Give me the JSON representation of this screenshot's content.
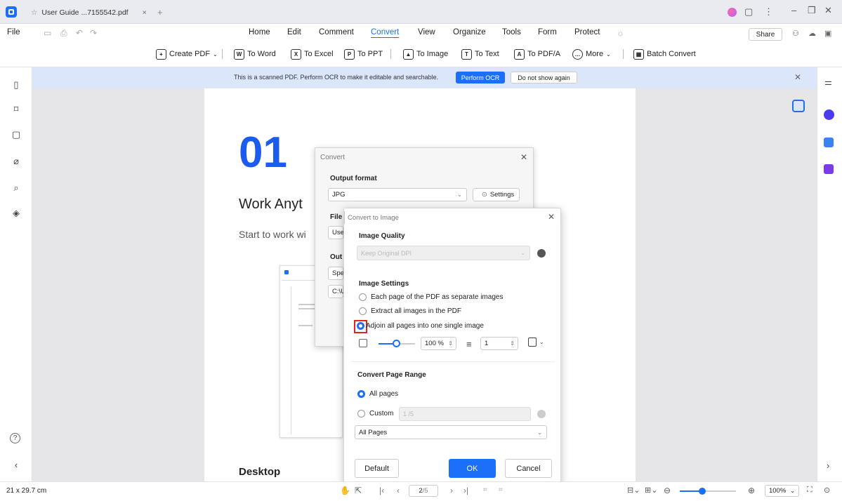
{
  "tab": {
    "title": "User Guide ...7155542.pdf"
  },
  "menubar": {
    "file": "File",
    "items": [
      "Home",
      "Edit",
      "Comment",
      "Convert",
      "View",
      "Organize",
      "Tools",
      "Form",
      "Protect"
    ],
    "share": "Share"
  },
  "toolbar": {
    "create_pdf": "Create PDF",
    "to_word": "To Word",
    "to_excel": "To Excel",
    "to_ppt": "To PPT",
    "to_image": "To Image",
    "to_text": "To Text",
    "to_pdfa": "To PDF/A",
    "more": "More",
    "batch_convert": "Batch Convert"
  },
  "ocr_bar": {
    "message": "This is a scanned PDF. Perform OCR to make it editable and searchable.",
    "perform": "Perform OCR",
    "dismiss": "Do not show again"
  },
  "document": {
    "number": "01",
    "title": "Work Anyt",
    "subtitle": "Start to work wi",
    "section": "Desktop"
  },
  "convert_dialog": {
    "title": "Convert",
    "output_format_label": "Output format",
    "output_format_value": "JPG",
    "settings": "Settings",
    "file_label": "File",
    "file_value": "User",
    "output_label": "Out",
    "output_value": "Spe",
    "path_value": "C:\\U"
  },
  "image_dialog": {
    "title": "Convert to Image",
    "quality_label": "Image Quality",
    "quality_value": "Keep Original DPI",
    "settings_label": "Image Settings",
    "opt_separate": "Each page of the PDF as separate images",
    "opt_extract": "Extract all images in the PDF",
    "opt_adjoin": "Adjoin all pages into one single image",
    "scale_value": "100 %",
    "columns_value": "1",
    "range_label": "Convert Page Range",
    "range_all": "All pages",
    "range_custom": "Custom",
    "range_custom_value": "1 /5",
    "pages_select": "All Pages",
    "default": "Default",
    "ok": "OK",
    "cancel": "Cancel"
  },
  "statusbar": {
    "size": "21 x 29.7 cm",
    "page": "2",
    "page_total": "/5",
    "zoom": "100%"
  }
}
